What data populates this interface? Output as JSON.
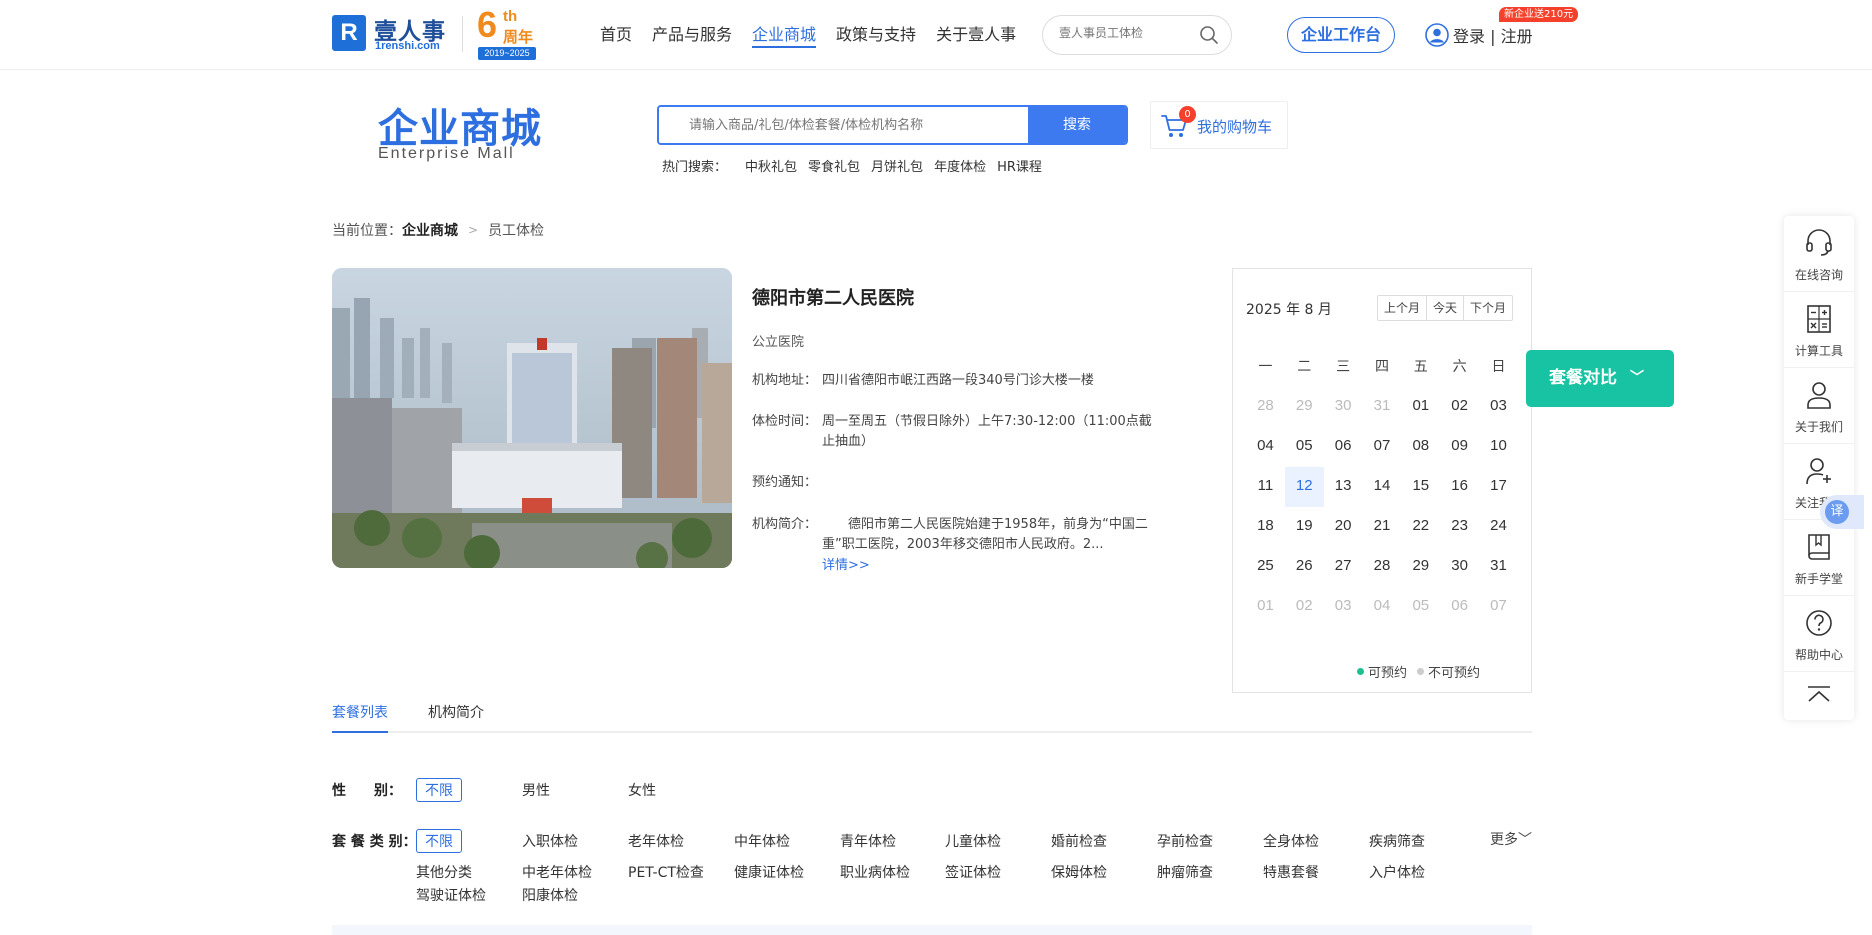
{
  "brand": {
    "logo_mark": "R",
    "logo_cn": "壹人事",
    "logo_en": "1renshi.com",
    "anniv_big": "6",
    "anniv_th": "th",
    "anniv_zn": "周年",
    "anniv_years": "2019~2025"
  },
  "nav": {
    "links": [
      "首页",
      "产品与服务",
      "企业商城",
      "政策与支持",
      "关于壹人事"
    ],
    "active_index": 2,
    "search_placeholder": "壹人事员工体检",
    "workbench": "企业工作台",
    "login": "登录 | 注册",
    "promo": "新企业送210元"
  },
  "mall": {
    "title": "企业商城",
    "subtitle": "Enterprise  Mall",
    "search_placeholder": "请输入商品/礼包/体检套餐/体检机构名称",
    "search_button": "搜索",
    "cart_count": "0",
    "cart_label": "我的购物车",
    "hot_label": "热门搜索：",
    "hot_items": [
      "中秋礼包",
      "零食礼包",
      "月饼礼包",
      "年度体检",
      "HR课程"
    ]
  },
  "breadcrumb": {
    "prefix": "当前位置：",
    "level1": "企业商城",
    "level2": "员工体检"
  },
  "institution": {
    "name": "德阳市第二人民医院",
    "type": "公立医院",
    "address_key": "机构地址：",
    "address": "四川省德阳市岷江西路一段340号门诊大楼一楼",
    "hours_key": "体检时间：",
    "hours": "周一至周五（节假日除外）上午7:30-12:00（11:00点截止抽血）",
    "notice_key": "预约通知：",
    "notice": "",
    "intro_key": "机构简介：",
    "intro": "德阳市第二人民医院始建于1958年，前身为“中国二重”职工医院，2003年移交德阳市人民政府。2...",
    "detail_link": "详情>>"
  },
  "calendar": {
    "month_label": "2025 年 8 月",
    "nav": [
      "上个月",
      "今天",
      "下个月"
    ],
    "weekdays": [
      "一",
      "二",
      "三",
      "四",
      "五",
      "六",
      "日"
    ],
    "weeks": [
      [
        "28",
        "29",
        "30",
        "31",
        "01",
        "02",
        "03"
      ],
      [
        "04",
        "05",
        "06",
        "07",
        "08",
        "09",
        "10"
      ],
      [
        "11",
        "12",
        "13",
        "14",
        "15",
        "16",
        "17"
      ],
      [
        "18",
        "19",
        "20",
        "21",
        "22",
        "23",
        "24"
      ],
      [
        "25",
        "26",
        "27",
        "28",
        "29",
        "30",
        "31"
      ],
      [
        "01",
        "02",
        "03",
        "04",
        "05",
        "06",
        "07"
      ]
    ],
    "muted_cells": [
      [
        0,
        0
      ],
      [
        0,
        1
      ],
      [
        0,
        2
      ],
      [
        0,
        3
      ],
      [
        5,
        0
      ],
      [
        5,
        1
      ],
      [
        5,
        2
      ],
      [
        5,
        3
      ],
      [
        5,
        4
      ],
      [
        5,
        5
      ],
      [
        5,
        6
      ]
    ],
    "today_cell": [
      2,
      1
    ],
    "legend_available": "可预约",
    "legend_unavailable": "不可预约",
    "available_color": "#1cc08e",
    "unavailable_color": "#cccccc"
  },
  "compare": {
    "label": "套餐对比",
    "chevron": "﹀"
  },
  "tabs": {
    "items": [
      "套餐列表",
      "机构简介"
    ],
    "active_index": 0
  },
  "filters": {
    "gender_label": "性　　别：",
    "gender_options": [
      "不限",
      "男性",
      "女性"
    ],
    "category_label": "套 餐 类 别：",
    "category_row1": [
      "不限",
      "入职体检",
      "老年体检",
      "中年体检",
      "青年体检",
      "儿童体检",
      "婚前检查",
      "孕前检查",
      "全身体检",
      "疾病筛查"
    ],
    "category_row2": [
      "其他分类",
      "中老年体检",
      "PET-CT检查",
      "健康证体检",
      "职业病体检",
      "签证体检",
      "保姆体检",
      "肿瘤筛查",
      "特惠套餐",
      "入户体检"
    ],
    "category_row3": [
      "驾驶证体检",
      "阳康体检"
    ],
    "more": "更多﹀"
  },
  "rail": {
    "items": [
      "在线咨询",
      "计算工具",
      "关于我们",
      "关注我们",
      "新手学堂",
      "帮助中心"
    ],
    "icons": [
      "headset-icon",
      "calculator-icon",
      "person-icon",
      "person-add-icon",
      "book-icon",
      "help-icon"
    ],
    "translate": "译"
  },
  "colors": {
    "accent": "#2e6fe0",
    "teal": "#17c3a2",
    "promo_red": "#f5412b",
    "anniv_orange": "#f08a1c"
  }
}
